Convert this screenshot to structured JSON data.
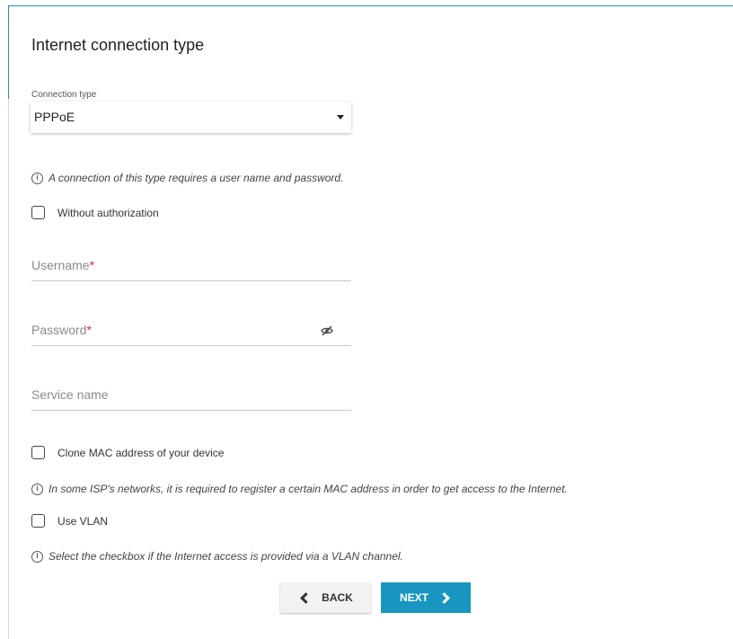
{
  "page": {
    "title": "Internet connection type"
  },
  "connection": {
    "label": "Connection type",
    "selected": "PPPoE"
  },
  "info": {
    "auth_note": "A connection of this type requires a user name and password.",
    "mac_note": "In some ISP's networks, it is required to register a certain MAC address in order to get access to the Internet.",
    "vlan_note": "Select the checkbox if the Internet access is provided via a VLAN channel."
  },
  "checkboxes": {
    "without_auth": "Without authorization",
    "clone_mac": "Clone MAC address of your device",
    "use_vlan": "Use VLAN"
  },
  "fields": {
    "username": "Username",
    "password": "Password",
    "required_mark": "*",
    "service_name": "Service name"
  },
  "buttons": {
    "back": "BACK",
    "next": "NEXT"
  },
  "icons": {
    "info": "info-icon",
    "eye": "eye-off-icon",
    "back": "chevron-left-icon",
    "next": "chevron-right-icon"
  },
  "colors": {
    "accent": "#1896c0",
    "required": "#d32f2f"
  }
}
